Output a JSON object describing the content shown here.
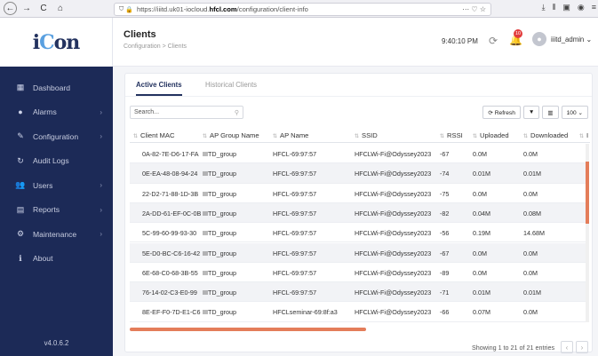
{
  "browser": {
    "url_prefix": "https://iiitd.uk01-iocloud.",
    "url_domain": "hfcl.com",
    "url_path": "/configuration/client-info",
    "url_actions": "··· ♡ ☆",
    "back_icon": "back-arrow-icon",
    "right_icons": [
      "download-icon",
      "library-icon",
      "sidebar-icon",
      "account-icon",
      "menu-icon"
    ]
  },
  "sidebar": {
    "logo_i": "i",
    "logo_c": "C",
    "logo_rest": "on",
    "items": [
      {
        "label": "Dashboard",
        "icon": "▦",
        "chevron": ""
      },
      {
        "label": "Alarms",
        "icon": "●",
        "chevron": "›"
      },
      {
        "label": "Configuration",
        "icon": "✎",
        "chevron": "›"
      },
      {
        "label": "Audit Logs",
        "icon": "↻",
        "chevron": ""
      },
      {
        "label": "Users",
        "icon": "👥",
        "chevron": "›"
      },
      {
        "label": "Reports",
        "icon": "▤",
        "chevron": "›"
      },
      {
        "label": "Maintenance",
        "icon": "⚙",
        "chevron": "›"
      },
      {
        "label": "About",
        "icon": "ℹ",
        "chevron": ""
      }
    ],
    "version": "v4.0.6.2"
  },
  "header": {
    "title": "Clients",
    "breadcrumb": "Configuration > Clients",
    "time": "9:40:10 PM",
    "notification_count": "10",
    "username": "iiitd_admin ⌄"
  },
  "tabs": {
    "active": "Active Clients",
    "historical": "Historical Clients"
  },
  "toolbar": {
    "search_placeholder": "Search...",
    "refresh_label": "⟳ Refresh",
    "filter_label": "▼",
    "columns_label": "▥",
    "page_size": "100 ⌄"
  },
  "table": {
    "columns": [
      "Client MAC",
      "AP Group Name",
      "AP Name",
      "SSID",
      "RSSI",
      "Uploaded",
      "Downloaded",
      "I"
    ],
    "rows": [
      [
        "0A-82-7E-D6-17-FA",
        "IIITD_group",
        "HFCL-69:97:57",
        "HFCLWi-Fi@Odyssey2023",
        "-67",
        "0.0M",
        "0.0M"
      ],
      [
        "0E-EA-48-08-94-24",
        "IIITD_group",
        "HFCL-69:97:57",
        "HFCLWi-Fi@Odyssey2023",
        "-74",
        "0.01M",
        "0.01M"
      ],
      [
        "22-D2-71-88-1D-3B",
        "IIITD_group",
        "HFCL-69:97:57",
        "HFCLWi-Fi@Odyssey2023",
        "-75",
        "0.0M",
        "0.0M"
      ],
      [
        "2A-DD-61-EF-0C-0B",
        "IIITD_group",
        "HFCL-69:97:57",
        "HFCLWi-Fi@Odyssey2023",
        "-82",
        "0.04M",
        "0.08M"
      ],
      [
        "5C-99-60-99-93-30",
        "IIITD_group",
        "HFCL-69:97:57",
        "HFCLWi-Fi@Odyssey2023",
        "-56",
        "0.19M",
        "14.68M"
      ],
      [
        "5E-D0-BC-C6-16-42",
        "IIITD_group",
        "HFCL-69:97:57",
        "HFCLWi-Fi@Odyssey2023",
        "-67",
        "0.0M",
        "0.0M"
      ],
      [
        "6E-68-C0-68-3B-55",
        "IIITD_group",
        "HFCL-69:97:57",
        "HFCLWi-Fi@Odyssey2023",
        "-89",
        "0.0M",
        "0.0M"
      ],
      [
        "76-14-02-C3-E0-99",
        "IIITD_group",
        "HFCL-69:97:57",
        "HFCLWi-Fi@Odyssey2023",
        "-71",
        "0.01M",
        "0.01M"
      ],
      [
        "8E-EF-F0-7D-E1-C6",
        "IIITD_group",
        "HFCLseminar-69:8f:a3",
        "HFCLWi-Fi@Odyssey2023",
        "-66",
        "0.07M",
        "0.0M"
      ]
    ]
  },
  "footer": {
    "info": "Showing 1 to 21 of 21 entries",
    "prev": "‹",
    "next": "›"
  },
  "colors": {
    "sidebar_bg": "#1c2a57",
    "accent": "#23325f",
    "scrollbar": "#e47d5a",
    "notification_badge": "#e23b3b"
  }
}
